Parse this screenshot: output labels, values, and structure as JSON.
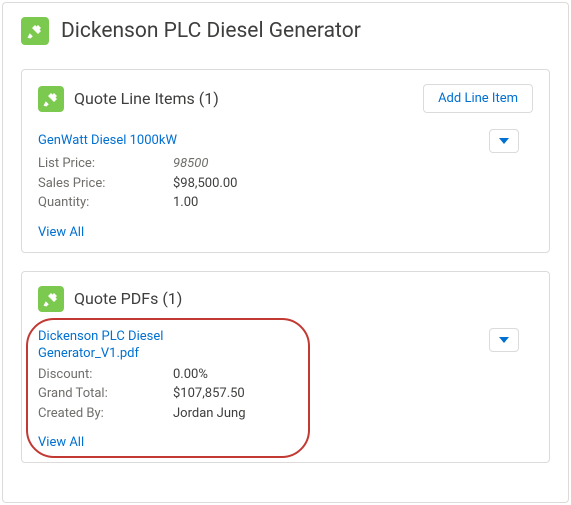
{
  "page": {
    "title": "Dickenson PLC Diesel Generator"
  },
  "lineItems": {
    "headerLabel": "Quote Line Items",
    "count": "(1)",
    "addButtonLabel": "Add Line Item",
    "item": {
      "name": "GenWatt Diesel 1000kW",
      "listPriceLabel": "List Price:",
      "listPriceValue": "98500",
      "salesPriceLabel": "Sales Price:",
      "salesPriceValue": "$98,500.00",
      "quantityLabel": "Quantity:",
      "quantityValue": "1.00"
    },
    "viewAllLabel": "View All"
  },
  "pdfs": {
    "headerLabel": "Quote PDFs",
    "count": "(1)",
    "item": {
      "name": "Dickenson PLC Diesel Generator_V1.pdf",
      "discountLabel": "Discount:",
      "discountValue": "0.00%",
      "grandTotalLabel": "Grand Total:",
      "grandTotalValue": "$107,857.50",
      "createdByLabel": "Created By:",
      "createdByValue": "Jordan Jung"
    },
    "viewAllLabel": "View All"
  }
}
